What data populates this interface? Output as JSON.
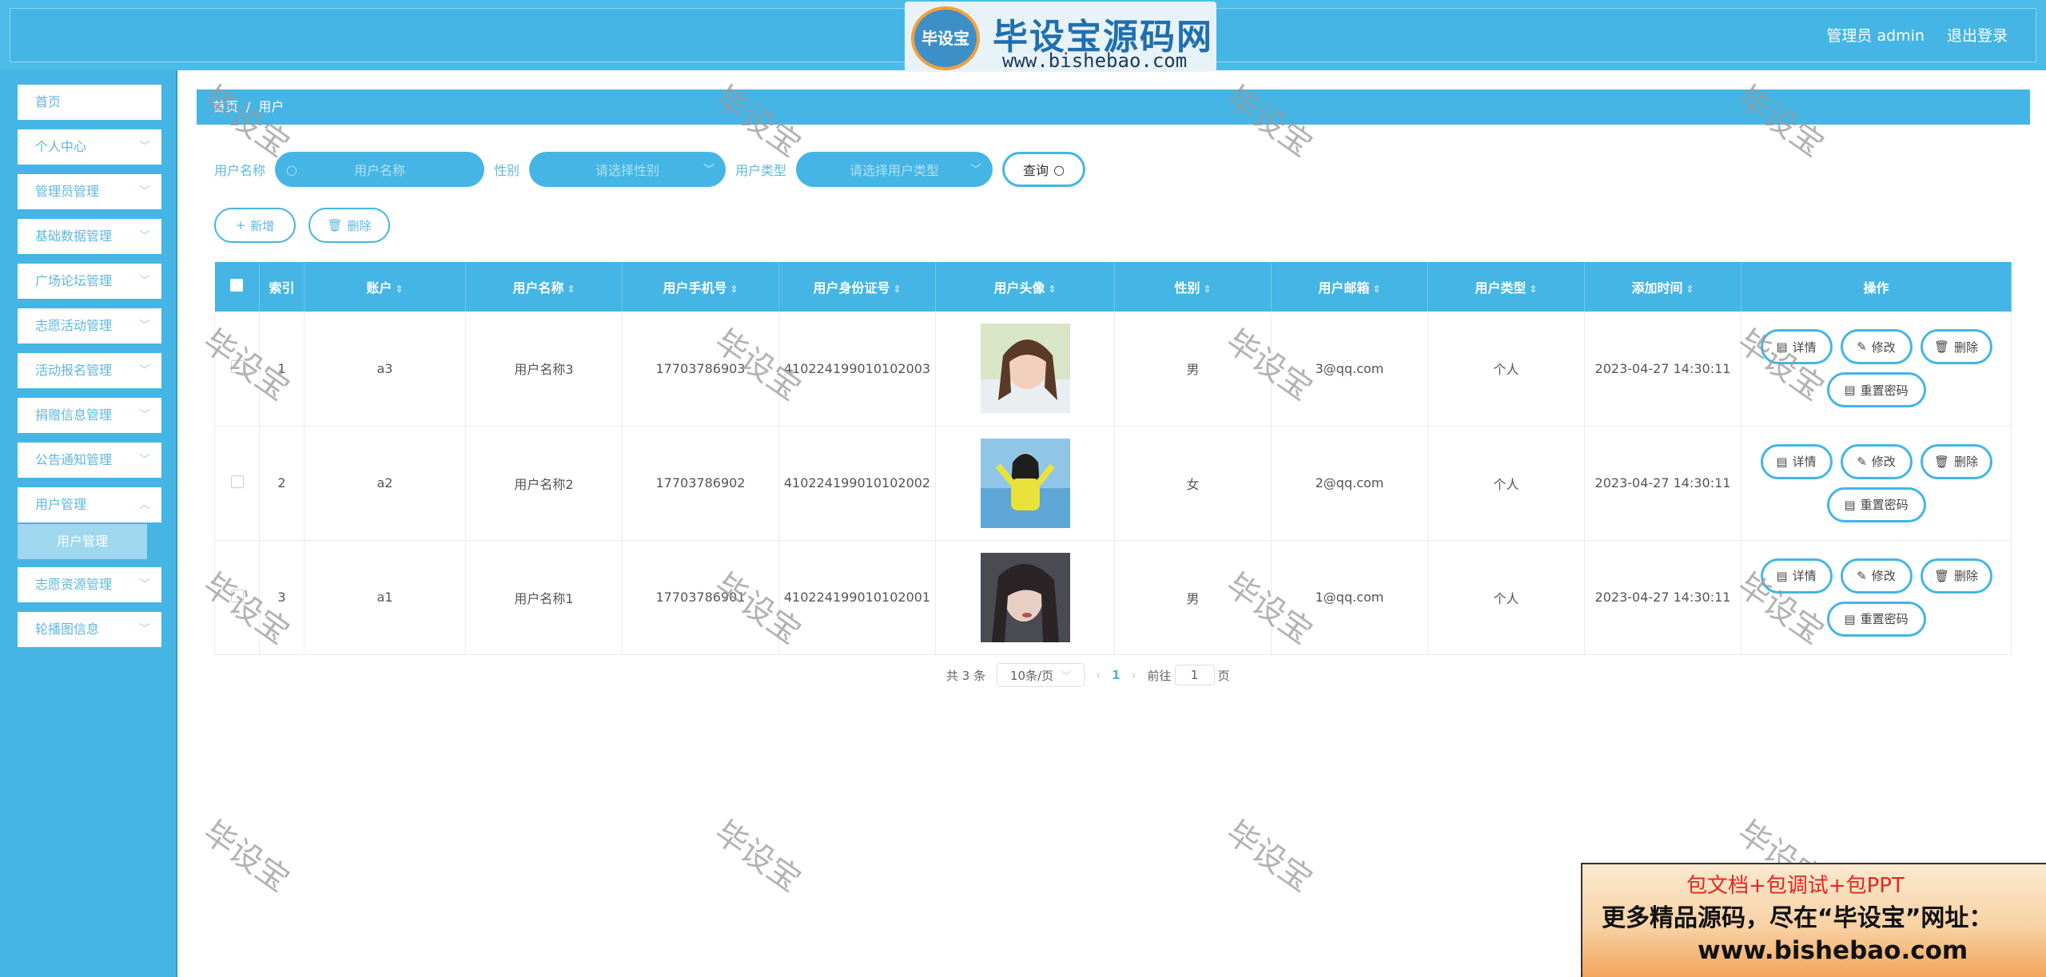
{
  "header": {
    "user_label": "管理员 admin",
    "logout": "退出登录",
    "logo_badge": "毕设宝",
    "logo_title": "毕设宝源码网",
    "logo_url": "www.bishebao.com"
  },
  "sidebar": {
    "items": [
      {
        "label": "首页",
        "has_chevron": false
      },
      {
        "label": "个人中心",
        "has_chevron": true
      },
      {
        "label": "管理员管理",
        "has_chevron": true
      },
      {
        "label": "基础数据管理",
        "has_chevron": true
      },
      {
        "label": "广场论坛管理",
        "has_chevron": true
      },
      {
        "label": "志愿活动管理",
        "has_chevron": true
      },
      {
        "label": "活动报名管理",
        "has_chevron": true
      },
      {
        "label": "捐赠信息管理",
        "has_chevron": true
      },
      {
        "label": "公告通知管理",
        "has_chevron": true
      },
      {
        "label": "用户管理",
        "has_chevron": true
      },
      {
        "label": "志愿资源管理",
        "has_chevron": true
      },
      {
        "label": "轮播图信息",
        "has_chevron": true
      }
    ],
    "submenu_active": "用户管理"
  },
  "breadcrumb": {
    "home": "首页",
    "sep": "/",
    "current": "用户"
  },
  "search": {
    "username_label": "用户名称",
    "username_placeholder": "用户名称",
    "gender_label": "性别",
    "gender_placeholder": "请选择性别",
    "type_label": "用户类型",
    "type_placeholder": "请选择用户类型",
    "query_button": "查询"
  },
  "actions": {
    "add": "新增",
    "delete": "删除"
  },
  "table": {
    "columns": [
      "索引",
      "账户",
      "用户名称",
      "用户手机号",
      "用户身份证号",
      "用户头像",
      "性别",
      "用户邮箱",
      "用户类型",
      "添加时间",
      "操作"
    ],
    "rows": [
      {
        "index": "1",
        "account": "a3",
        "name": "用户名称3",
        "phone": "17703786903",
        "id_card": "410224199010102003",
        "gender": "男",
        "email": "3@qq.com",
        "type": "个人",
        "created": "2023-04-27 14:30:11"
      },
      {
        "index": "2",
        "account": "a2",
        "name": "用户名称2",
        "phone": "17703786902",
        "id_card": "410224199010102002",
        "gender": "女",
        "email": "2@qq.com",
        "type": "个人",
        "created": "2023-04-27 14:30:11"
      },
      {
        "index": "3",
        "account": "a1",
        "name": "用户名称1",
        "phone": "17703786901",
        "id_card": "410224199010102001",
        "gender": "男",
        "email": "1@qq.com",
        "type": "个人",
        "created": "2023-04-27 14:30:11"
      }
    ],
    "ops": {
      "detail": "详情",
      "edit": "修改",
      "delete": "删除",
      "reset": "重置密码"
    }
  },
  "pagination": {
    "total": "共 3 条",
    "page_size": "10条/页",
    "current": "1",
    "goto_prefix": "前往",
    "goto_value": "1",
    "goto_suffix": "页"
  },
  "watermark": "毕设宝",
  "ad": {
    "line1": "包文档+包调试+包PPT",
    "line2": "更多精品源码，尽在“毕设宝”网址：",
    "line3": "www.bishebao.com"
  },
  "colors": {
    "primary": "#44b5e5",
    "header": "#4cbbe8",
    "ad_red": "#e0281e"
  }
}
